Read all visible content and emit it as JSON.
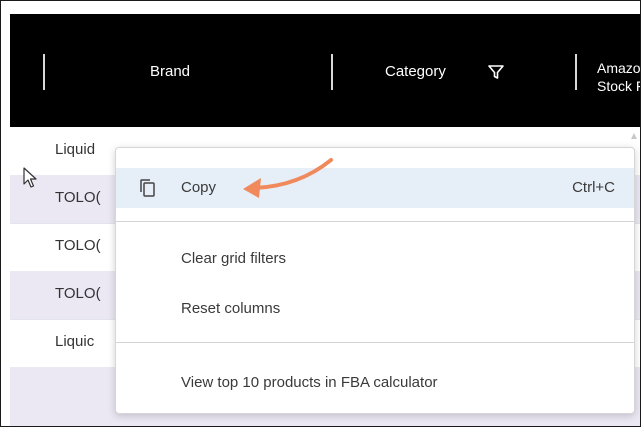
{
  "grid": {
    "columns": {
      "brand": "Brand",
      "category": "Category",
      "amazon_line1": "Amazo",
      "amazon_line2": "Stock F"
    },
    "rows": [
      {
        "brand": "Liquid"
      },
      {
        "brand": "TOLO("
      },
      {
        "brand": "TOLO("
      },
      {
        "brand": "TOLO("
      },
      {
        "brand": "Liquic"
      }
    ]
  },
  "context_menu": {
    "items": {
      "copy": {
        "label": "Copy",
        "shortcut": "Ctrl+C",
        "icon": "copy-icon"
      },
      "clear_filters": {
        "label": "Clear grid filters"
      },
      "reset_columns": {
        "label": "Reset columns"
      },
      "view_fba": {
        "label": "View top 10 products in FBA calculator"
      }
    }
  },
  "colors": {
    "header_bg": "#000000",
    "row_alt": "#ebe8f4",
    "menu_highlight": "#e6eef8",
    "annotation_arrow": "#f08a5d"
  }
}
